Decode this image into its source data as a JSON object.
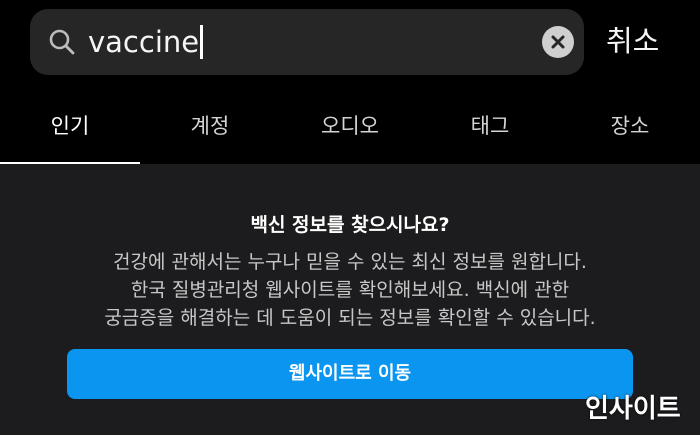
{
  "search": {
    "query": "vaccine",
    "icon": "search-icon",
    "clear_icon": "close-circle-icon"
  },
  "cancel_label": "취소",
  "tabs": [
    {
      "label": "인기",
      "active": true
    },
    {
      "label": "계정",
      "active": false
    },
    {
      "label": "오디오",
      "active": false
    },
    {
      "label": "태그",
      "active": false
    },
    {
      "label": "장소",
      "active": false
    }
  ],
  "notice": {
    "title": "백신 정보를 찾으시나요?",
    "body_lines": [
      "건강에 관해서는 누구나 믿을 수 있는 최신 정보를 원합니다.",
      "한국 질병관리청 웹사이트를 확인해보세요. 백신에 관한",
      "궁금증을 해결하는 데 도움이 되는 정보를 확인할 수 있습니다."
    ],
    "button_label": "웹사이트로 이동"
  },
  "watermark": "인사이트",
  "colors": {
    "background": "#000000",
    "search_bg": "#262626",
    "panel_bg": "#1c1c1e",
    "button_blue": "#0a95f0",
    "text_primary": "#ffffff",
    "text_secondary": "#c7c7c7"
  }
}
